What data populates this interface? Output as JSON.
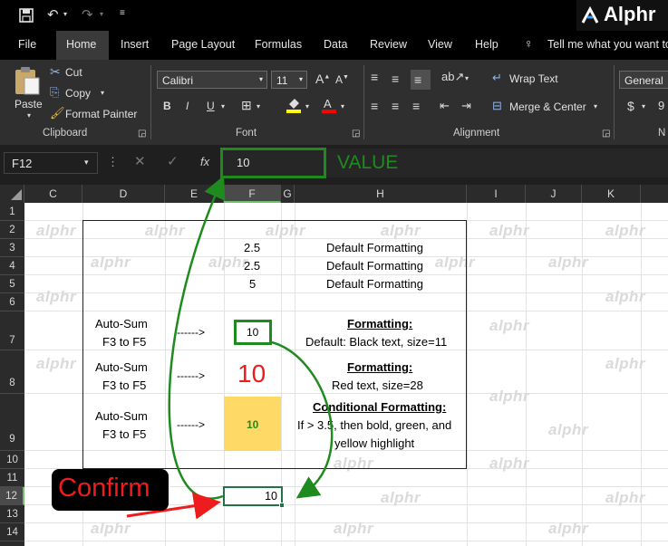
{
  "titlebar": {
    "brand": "Alphr"
  },
  "menu": [
    "File",
    "Home",
    "Insert",
    "Page Layout",
    "Formulas",
    "Data",
    "Review",
    "View",
    "Help"
  ],
  "tell_me": "Tell me what you want to",
  "ribbon": {
    "paste": "Paste",
    "cut": "Cut",
    "copy": "Copy",
    "format_painter": "Format Painter",
    "clipboard": "Clipboard",
    "font_name": "Calibri",
    "font_size": "11",
    "bold": "B",
    "italic": "I",
    "underline": "U",
    "font_group": "Font",
    "wrap_text": "Wrap Text",
    "merge_center": "Merge & Center",
    "alignment": "Alignment",
    "number_format": "General",
    "currency": "$",
    "number_group_partial": "N",
    "percent_partial": "9"
  },
  "formula_bar": {
    "name_box": "F12",
    "fx": "fx",
    "value": "10",
    "annotation": "VALUE"
  },
  "columns": [
    "C",
    "D",
    "E",
    "F",
    "G",
    "H",
    "I",
    "J",
    "K"
  ],
  "rows": [
    "1",
    "2",
    "3",
    "4",
    "5",
    "6",
    "7",
    "8",
    "9",
    "10",
    "11",
    "12",
    "13",
    "14"
  ],
  "cells": {
    "f3": "2.5",
    "f4": "2.5",
    "f5": "5",
    "h3": "Default Formatting",
    "h4": "Default Formatting",
    "h5": "Default Formatting",
    "d7a": "Auto-Sum",
    "d7b": "F3 to F5",
    "e7": "------>",
    "f7": "10",
    "h7_title": "Formatting:",
    "h7_desc": "Default: Black text, size=11",
    "d8a": "Auto-Sum",
    "d8b": "F3 to F5",
    "e8": "------>",
    "f8": "10",
    "h8_title": "Formatting:",
    "h8_desc": "Red text, size=28",
    "d9a": "Auto-Sum",
    "d9b": "F3 to F5",
    "e9": "------>",
    "f9": "10",
    "h9_title": "Conditional Formatting:",
    "h9_desc1": "If > 3.5, then bold, green, and",
    "h9_desc2": "yellow highlight",
    "f12": "10"
  },
  "confirm_label": "Confirm",
  "watermark": "alphr",
  "colors": {
    "green": "#1e8b1e",
    "red": "#ee1c1c",
    "highlight": "#ffd966",
    "excel_green": "#217346"
  }
}
